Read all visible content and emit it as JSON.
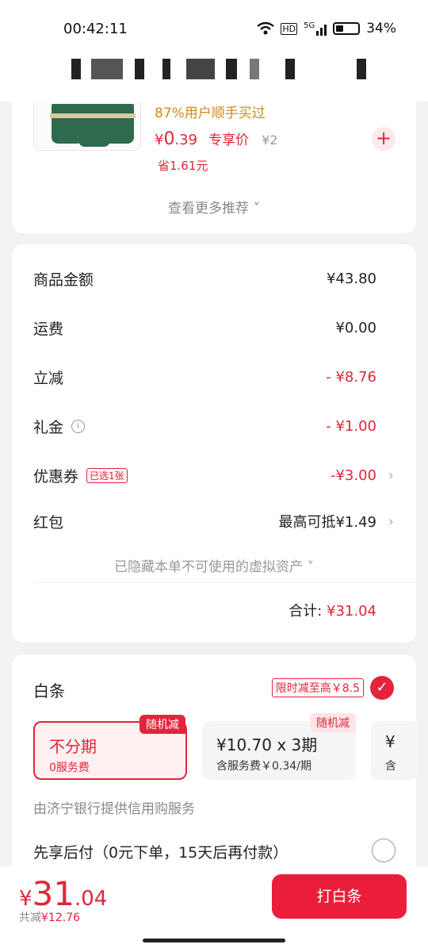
{
  "status_bar": {
    "time": "00:42:11",
    "network": "5G",
    "hd": "HD",
    "battery": "34%"
  },
  "recommendation": {
    "buy_stat": "87%用户顺手买过",
    "currency": "¥",
    "price_int": "0",
    "price_dec": ".39",
    "exclusive_label": "专享价",
    "original_price": "¥2",
    "saved": "省1.61元",
    "add_symbol": "+",
    "more_label": "查看更多推荐 ˅"
  },
  "summary": {
    "rows": [
      {
        "label": "商品金额",
        "value": "¥43.80"
      },
      {
        "label": "运费",
        "value": "¥0.00"
      },
      {
        "label": "立减",
        "value": "- ¥8.76"
      },
      {
        "label": "礼金",
        "value": "- ¥1.00"
      },
      {
        "label": "优惠券",
        "tag": "已选1张",
        "value": "-¥3.00"
      },
      {
        "label": "红包",
        "value": "最高可抵¥1.49"
      }
    ],
    "hidden_assets": "已隐藏本单不可使用的虚拟资产 ˅",
    "total_label": "合计:",
    "total_value": "¥31.04"
  },
  "baitiao": {
    "title": "白条",
    "promo": "限时减至高￥8.5",
    "plans": [
      {
        "tag": "随机减",
        "main": "不分期",
        "sub": "0服务费"
      },
      {
        "tag": "随机减",
        "main": "¥10.70 x 3期",
        "sub": "含服务费￥0.34/期"
      },
      {
        "main": "¥",
        "sub": "含"
      }
    ],
    "provider": "由济宁银行提供信用购服务",
    "bnpl": "先享后付（0元下单，15天后再付款）"
  },
  "footer": {
    "currency": "¥",
    "price_int": "31",
    "price_dec": ".04",
    "saved_label": "共减",
    "saved_value": "¥12.76",
    "pay_label": "打白条"
  },
  "colors": {
    "accent": "#e4243a",
    "orange": "#d48a1e"
  }
}
